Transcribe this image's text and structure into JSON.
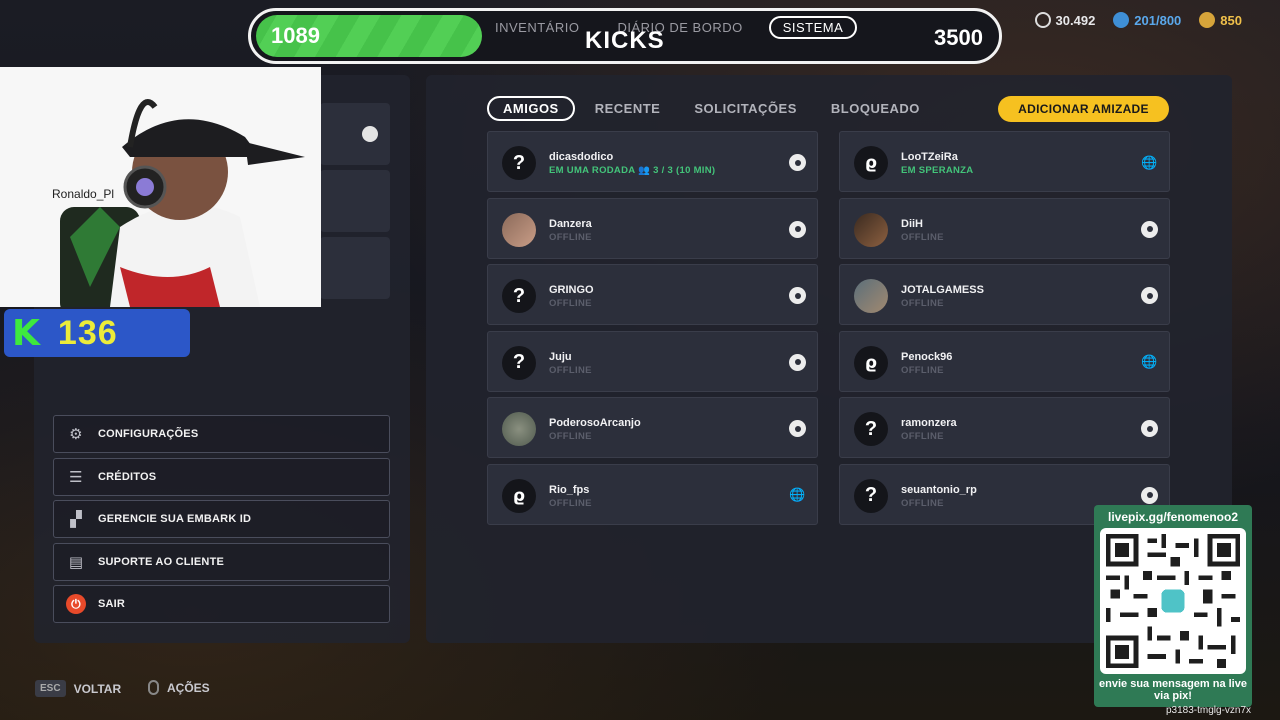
{
  "topbar": {
    "xp_value": "1089",
    "xp_fraction": 0.31,
    "nav": [
      "INVENTÁRIO",
      "DIÁRIO DE BORDO",
      "SISTEMA"
    ],
    "active_nav": "SISTEMA",
    "title": "KICKS",
    "target_value": "3500"
  },
  "currencies": [
    {
      "value": "30.492",
      "icon": "coin-icon",
      "color": "#ffffff"
    },
    {
      "value": "201/800",
      "icon": "bucks-icon",
      "color": "#5aa8ec"
    },
    {
      "value": "850",
      "icon": "gold-icon",
      "color": "#f0c04a"
    }
  ],
  "webcam": {
    "name_label": "Ronaldo_Pl"
  },
  "kbadge": {
    "letter": "K",
    "value": "136"
  },
  "menu": [
    {
      "label": "CONFIGURAÇÕES",
      "icon": "gear-icon"
    },
    {
      "label": "CRÉDITOS",
      "icon": "credits-icon"
    },
    {
      "label": "GERENCIE SUA EMBARK ID",
      "icon": "embark-icon"
    },
    {
      "label": "SUPORTE AO CLIENTE",
      "icon": "support-icon"
    },
    {
      "label": "SAIR",
      "icon": "power-icon"
    }
  ],
  "hints": {
    "esc_key": "ESC",
    "back": "VOLTAR",
    "actions": "AÇÕES"
  },
  "tabs": [
    "AMIGOS",
    "RECENTE",
    "SOLICITAÇÕES",
    "BLOQUEADO"
  ],
  "active_tab": "AMIGOS",
  "add_friend_label": "ADICIONAR AMIZADE",
  "friends_left": [
    {
      "name": "dicasdodico",
      "status": "EM UMA RODADA",
      "extra": "3 / 3 (10 MIN)",
      "avatar": "?",
      "platform": "steam",
      "online": true
    },
    {
      "name": "Danzera",
      "status": "OFFLINE",
      "avatar": "photo",
      "platform": "steam"
    },
    {
      "name": "GRINGO",
      "status": "OFFLINE",
      "avatar": "?",
      "platform": "steam"
    },
    {
      "name": "Juju",
      "status": "OFFLINE",
      "avatar": "?",
      "platform": "steam"
    },
    {
      "name": "PoderosoArcanjo",
      "status": "OFFLINE",
      "avatar": "photo4",
      "platform": "steam"
    },
    {
      "name": "Rio_fps",
      "status": "OFFLINE",
      "avatar": "logo",
      "platform": "globe"
    }
  ],
  "friends_right": [
    {
      "name": "LooTZeiRa",
      "status": "EM SPERANZA",
      "avatar": "logo",
      "platform": "globe",
      "online": true
    },
    {
      "name": "DiiH",
      "status": "OFFLINE",
      "avatar": "photo2",
      "platform": "steam"
    },
    {
      "name": "JOTALGAMESS",
      "status": "OFFLINE",
      "avatar": "photo3",
      "platform": "steam"
    },
    {
      "name": "Penock96",
      "status": "OFFLINE",
      "avatar": "logo",
      "platform": "globe"
    },
    {
      "name": "ramonzera",
      "status": "OFFLINE",
      "avatar": "?",
      "platform": "steam"
    },
    {
      "name": "seuantonio_rp",
      "status": "OFFLINE",
      "avatar": "?",
      "platform": "steam"
    }
  ],
  "qr": {
    "url": "livepix.gg/fenomenoo2",
    "message": "envie sua mensagem na live via pix!"
  },
  "session_code": "p3183-tmglg-vzn7x"
}
